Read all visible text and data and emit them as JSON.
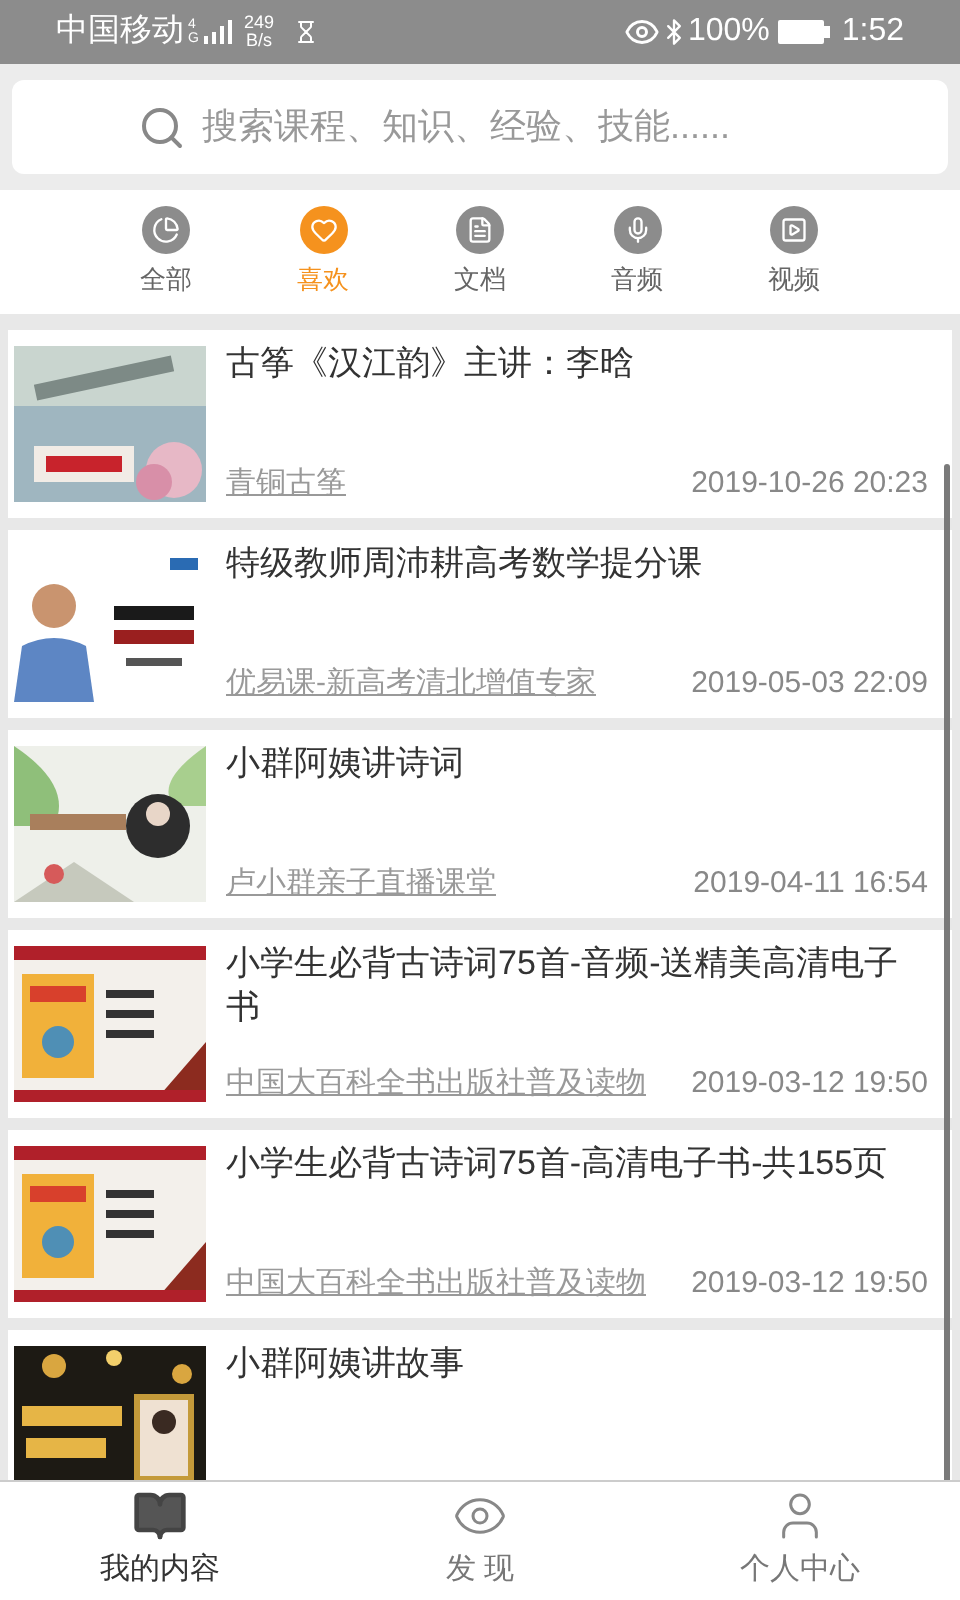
{
  "status_bar": {
    "carrier": "中国移动",
    "network": "4G",
    "speed_value": "249",
    "speed_unit": "B/s",
    "battery": "100%",
    "time": "1:52"
  },
  "search": {
    "placeholder": "搜索课程、知识、经验、技能......"
  },
  "tabs": [
    {
      "label": "全部",
      "selected": false
    },
    {
      "label": "喜欢",
      "selected": true
    },
    {
      "label": "文档",
      "selected": false
    },
    {
      "label": "音频",
      "selected": false
    },
    {
      "label": "视频",
      "selected": false
    }
  ],
  "items": [
    {
      "title": "古筝《汉江韵》主讲：李晗",
      "source": "青铜古筝",
      "date": "2019-10-26 20:23"
    },
    {
      "title": "特级教师周沛耕高考数学提分课",
      "source": "优易课-新高考清北增值专家",
      "date": "2019-05-03 22:09"
    },
    {
      "title": "小群阿姨讲诗词",
      "source": "卢小群亲子直播课堂",
      "date": "2019-04-11 16:54"
    },
    {
      "title": "小学生必背古诗词75首-音频-送精美高清电子书",
      "source": "中国大百科全书出版社普及读物",
      "date": "2019-03-12 19:50"
    },
    {
      "title": "小学生必背古诗词75首-高清电子书-共155页",
      "source": "中国大百科全书出版社普及读物",
      "date": "2019-03-12 19:50"
    },
    {
      "title": "小群阿姨讲故事"
    }
  ],
  "bottom_nav": [
    {
      "label": "我的内容",
      "selected": true
    },
    {
      "label": "发 现",
      "selected": false
    },
    {
      "label": "个人中心",
      "selected": false
    }
  ]
}
